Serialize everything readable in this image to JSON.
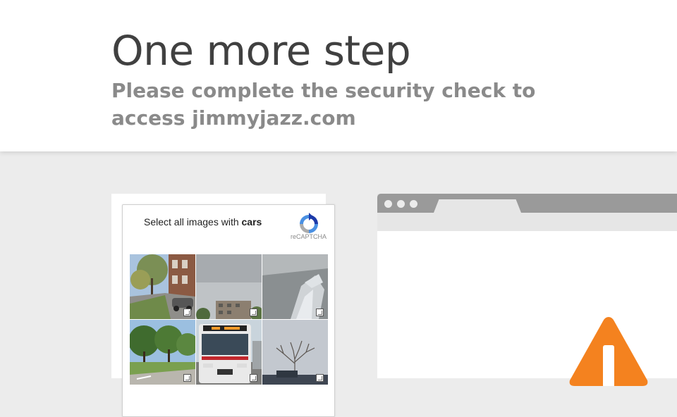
{
  "header": {
    "title": "One more step",
    "subtitle": "Please complete the security check to access jimmyjazz.com"
  },
  "captcha": {
    "prompt_prefix": "Select all images with",
    "prompt_target": "cars",
    "brand_label": "reCAPTCHA",
    "tiles": [
      {
        "name": "street-houses",
        "selected": false
      },
      {
        "name": "sky-building",
        "selected": false
      },
      {
        "name": "snow-sculpture",
        "selected": false
      },
      {
        "name": "park-trees",
        "selected": false
      },
      {
        "name": "bus",
        "selected": false
      },
      {
        "name": "bare-tree",
        "selected": false
      }
    ]
  },
  "browser_illustration": {
    "window_dots": 3,
    "icon": "warning-icon",
    "colors": {
      "warning": "#f4821f",
      "chrome": "#9a9a9a"
    }
  }
}
